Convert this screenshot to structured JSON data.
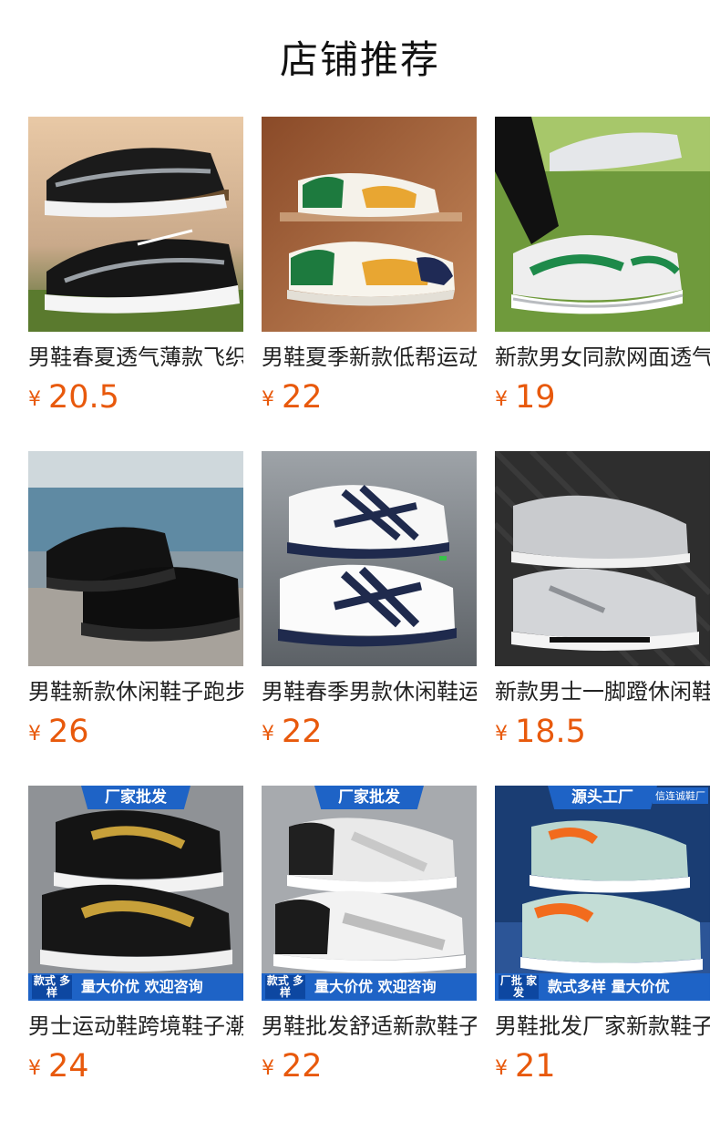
{
  "header": {
    "title": "店铺推荐"
  },
  "products": [
    {
      "name": "男鞋春夏透气薄款飞织",
      "currency": "¥",
      "price": "20.5"
    },
    {
      "name": "男鞋夏季新款低帮运动",
      "currency": "¥",
      "price": "22"
    },
    {
      "name": "新款男女同款网面透气",
      "currency": "¥",
      "price": "19"
    },
    {
      "name": "男鞋新款休闲鞋子跑步",
      "currency": "¥",
      "price": "26"
    },
    {
      "name": "男鞋春季男款休闲鞋运",
      "currency": "¥",
      "price": "22"
    },
    {
      "name": "新款男士一脚蹬休闲鞋",
      "currency": "¥",
      "price": "18.5"
    },
    {
      "name": "男士运动鞋跨境鞋子潮",
      "currency": "¥",
      "price": "24",
      "badge_top": "厂家批发",
      "badge_tag": "款式 多样",
      "badge_bottom": "量大价优 欢迎咨询"
    },
    {
      "name": "男鞋批发舒适新款鞋子",
      "currency": "¥",
      "price": "22",
      "badge_top": "厂家批发",
      "badge_tag": "款式 多样",
      "badge_bottom": "量大价优 欢迎咨询"
    },
    {
      "name": "男鞋批发厂家新款鞋子",
      "currency": "¥",
      "price": "21",
      "badge_top": "源头工厂",
      "badge_brand": "信连诚鞋厂",
      "badge_tag": "厂批 家发",
      "badge_bottom": "款式多样 量大价优"
    }
  ],
  "colors": {
    "price": "#e8590c",
    "badge": "#1e63c6"
  }
}
